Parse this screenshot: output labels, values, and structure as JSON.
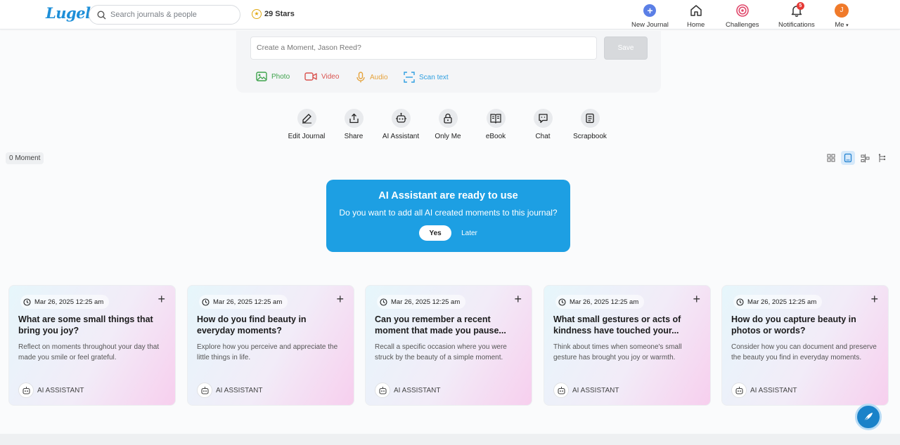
{
  "brand": {
    "logo_text": "Lugelo",
    "accent": "#1d9fe3"
  },
  "search": {
    "placeholder": "Search journals & people"
  },
  "stars": {
    "label": "29 Stars"
  },
  "nav": {
    "new_journal": "New Journal",
    "home": "Home",
    "challenges": "Challenges",
    "notifications": "Notifications",
    "notifications_count": "5",
    "me": "Me",
    "avatar_initial": "J"
  },
  "composer": {
    "placeholder": "Create a Moment, Jason Reed?",
    "save_label": "Save",
    "photo": "Photo",
    "video": "Video",
    "audio": "Audio",
    "scan": "Scan text"
  },
  "actions": {
    "edit": "Edit Journal",
    "share": "Share",
    "ai": "AI Assistant",
    "only_me": "Only Me",
    "ebook": "eBook",
    "chat": "Chat",
    "scrapbook": "Scrapbook"
  },
  "moment_count": "0 Moment",
  "ai_banner": {
    "title": "AI Assistant are ready to use",
    "question": "Do you want to add all AI created moments to this journal?",
    "yes": "Yes",
    "later": "Later"
  },
  "cards": [
    {
      "date": "Mar 26, 2025 12:25 am",
      "title": "What are some small things that bring you joy?",
      "desc": "Reflect on moments throughout your day that made you smile or feel grateful.",
      "author": "AI ASSISTANT"
    },
    {
      "date": "Mar 26, 2025 12:25 am",
      "title": "How do you find beauty in everyday moments?",
      "desc": "Explore how you perceive and appreciate the little things in life.",
      "author": "AI ASSISTANT"
    },
    {
      "date": "Mar 26, 2025 12:25 am",
      "title": "Can you remember a recent moment that made you pause...",
      "desc": "Recall a specific occasion where you were struck by the beauty of a simple moment.",
      "author": "AI ASSISTANT"
    },
    {
      "date": "Mar 26, 2025 12:25 am",
      "title": "What small gestures or acts of kindness have touched your...",
      "desc": "Think about times when someone's small gesture has brought you joy or warmth.",
      "author": "AI ASSISTANT"
    },
    {
      "date": "Mar 26, 2025 12:25 am",
      "title": "How do you capture beauty in photos or words?",
      "desc": "Consider how you can document and preserve the beauty you find in everyday moments.",
      "author": "AI ASSISTANT"
    }
  ],
  "add_symbol": "+"
}
